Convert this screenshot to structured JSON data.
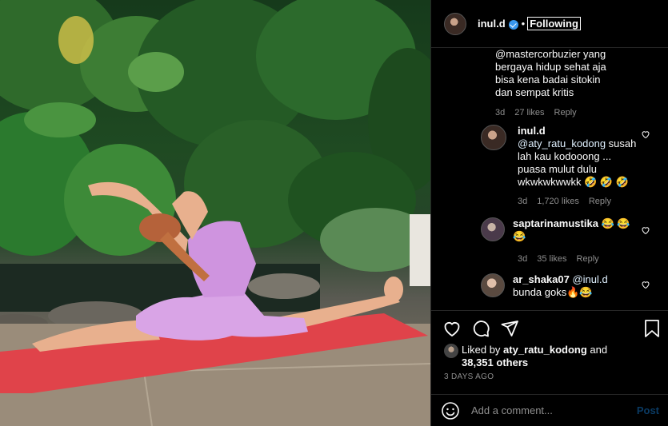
{
  "header": {
    "username": "inul.d",
    "separator": "•",
    "follow_label": "Following"
  },
  "comments": [
    {
      "text_lines": [
        "@mastercorbuzier yang",
        "bergaya hidup sehat aja",
        "bisa kena badai sitokin",
        "dan sempat kritis"
      ],
      "time": "3d",
      "likes": "27 likes",
      "reply_label": "Reply"
    },
    {
      "username": "inul.d",
      "mention": "@aty_ratu_kodong",
      "text_after": " susah lah kau kodooong ... puasa mulut dulu wkwkwkwwkk 🤣 🤣 🤣",
      "time": "3d",
      "likes": "1,720 likes",
      "reply_label": "Reply"
    },
    {
      "username": "saptarinamustika",
      "text_after": " 😂 😂 😂",
      "time": "3d",
      "likes": "35 likes",
      "reply_label": "Reply"
    },
    {
      "username": "ar_shaka07",
      "mention": "@inul.d",
      "text_after": "bunda goks🔥😂"
    }
  ],
  "likes": {
    "prefix": "Liked by ",
    "user": "aty_ratu_kodong",
    "and": " and",
    "others": "38,351 others"
  },
  "timestamp": "3 DAYS AGO",
  "add_comment": {
    "placeholder": "Add a comment...",
    "post_label": "Post"
  },
  "icons": {
    "like": "heart-icon",
    "comment": "comment-icon",
    "share": "share-icon",
    "save": "bookmark-icon",
    "emoji": "smiley-icon"
  },
  "colors": {
    "background": "#000000",
    "text": "#fafafa",
    "muted": "#8e8e8e",
    "verified": "#3897f0",
    "post_disabled": "#0a3a63",
    "mat": "#e0434a",
    "outfit": "#d9a4e6"
  }
}
